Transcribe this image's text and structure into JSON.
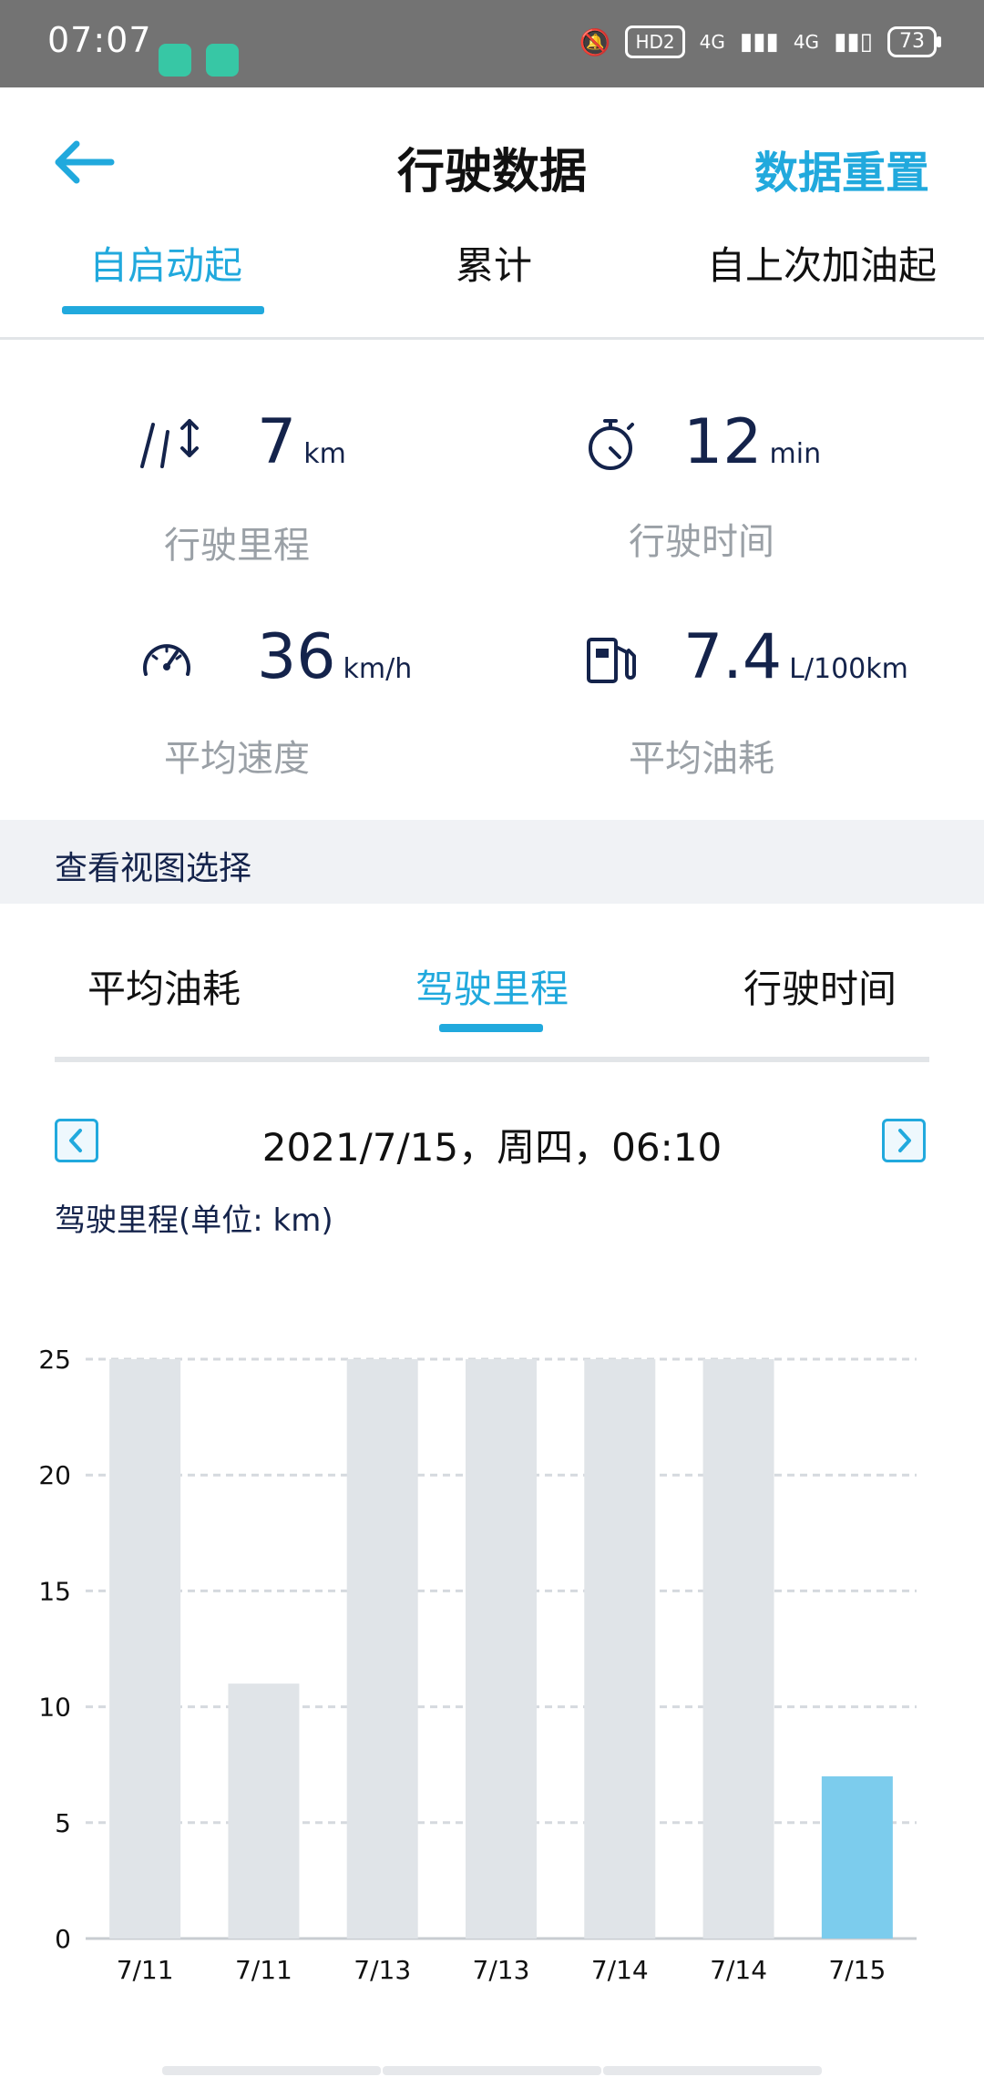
{
  "status_bar": {
    "time": "07:07",
    "hd_badge": "HD2",
    "network_1": "4G",
    "network_2": "4G",
    "battery": "73"
  },
  "header": {
    "title": "行驶数据",
    "reset_label": "数据重置"
  },
  "scope_tabs": [
    {
      "label": "自启动起",
      "active": true
    },
    {
      "label": "累计",
      "active": false
    },
    {
      "label": "自上次加油起",
      "active": false
    }
  ],
  "stats": {
    "distance": {
      "value": "7",
      "unit": "km",
      "label": "行驶里程",
      "icon": "road-icon"
    },
    "time": {
      "value": "12",
      "unit": "min",
      "label": "行驶时间",
      "icon": "stopwatch-icon"
    },
    "speed": {
      "value": "36",
      "unit": "km/h",
      "label": "平均速度",
      "icon": "speedometer-icon"
    },
    "fuel": {
      "value": "7.4",
      "unit": "L/100km",
      "label": "平均油耗",
      "icon": "fuel-pump-icon"
    }
  },
  "view_section": {
    "label": "查看视图选择"
  },
  "view_tabs": [
    {
      "label": "平均油耗",
      "active": false
    },
    {
      "label": "驾驶里程",
      "active": true
    },
    {
      "label": "行驶时间",
      "active": false
    }
  ],
  "date_nav": {
    "current": "2021/7/15，周四，06:10"
  },
  "chart_subtitle": "驾驶里程(单位: km)",
  "colors": {
    "accent": "#21a9dd",
    "bar_default": "#e0e4e8",
    "bar_active": "#7ccced",
    "dark_text": "#14234b"
  },
  "chart_data": {
    "type": "bar",
    "title": "驾驶里程(单位: km)",
    "categories": [
      "7/11",
      "7/11",
      "7/13",
      "7/13",
      "7/14",
      "7/14",
      "7/15"
    ],
    "values": [
      25,
      11,
      25,
      25,
      25,
      25,
      7
    ],
    "highlight_index": 6,
    "ylim": [
      0,
      25
    ],
    "yticks": [
      0,
      5,
      10,
      15,
      20,
      25
    ],
    "grid": true,
    "xlabel": "",
    "ylabel": ""
  }
}
